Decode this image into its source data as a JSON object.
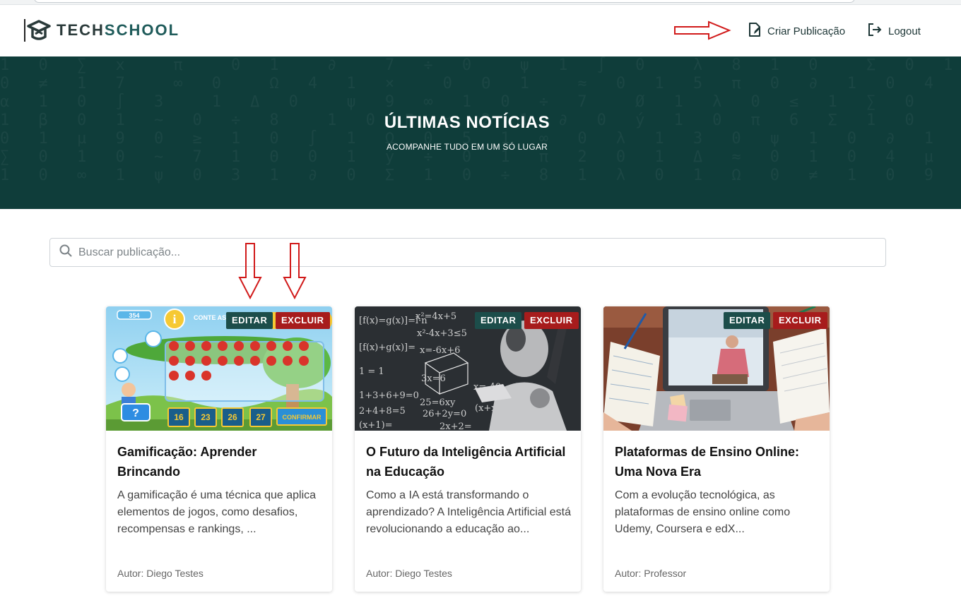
{
  "header": {
    "logo_part1": "TECH",
    "logo_part2": "SCHOOL",
    "create_label": "Criar Publicação",
    "logout_label": "Logout"
  },
  "hero": {
    "title": "ÚLTIMAS NOTÍCIAS",
    "subtitle": "ACOMPANHE TUDO EM UM SÓ LUGAR"
  },
  "search": {
    "placeholder": "Buscar publicação...",
    "value": ""
  },
  "cards": [
    {
      "title": "Gamificação: Aprender Brincando",
      "description": "A gamificação é uma técnica que aplica elementos de jogos, como desafios, recompensas e rankings, ...",
      "author": "Autor: Diego Testes",
      "edit_label": "EDITAR",
      "delete_label": "EXCLUIR",
      "image_text": [
        "354",
        "CONTE AS",
        "16",
        "23",
        "26",
        "27",
        "CONFIRMAR",
        "?"
      ]
    },
    {
      "title": "O Futuro da Inteligência Artificial na Educação",
      "description": "Como a IA está transformando o aprendizado? A Inteligência Artificial está revolucionando a educação ao...",
      "author": "Autor: Diego Testes",
      "edit_label": "EDITAR",
      "delete_label": "EXCLUIR"
    },
    {
      "title": "Plataformas de Ensino Online: Uma Nova Era",
      "description": "Com a evolução tecnológica, as plataformas de ensino online como Udemy, Coursera e edX...",
      "author": "Autor: Professor",
      "edit_label": "EDITAR",
      "delete_label": "EXCLUIR"
    }
  ],
  "colors": {
    "brand_dark": "#0f3d3a",
    "edit_badge": "#1c4d4a",
    "delete_badge": "#a71c1c",
    "annotation_arrow": "#d11a1a"
  },
  "icons": [
    "graduation-cap-icon",
    "edit-document-icon",
    "logout-icon",
    "search-icon"
  ]
}
